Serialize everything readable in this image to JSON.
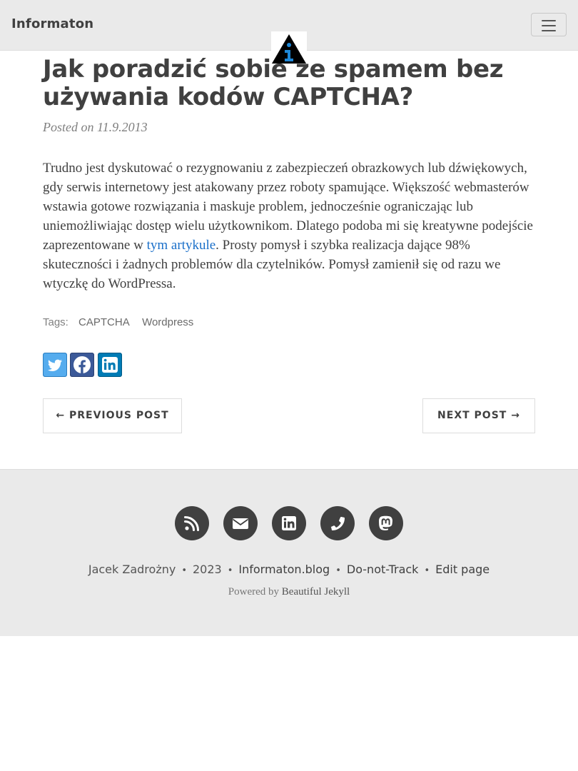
{
  "navbar": {
    "brand": "Informaton",
    "toggler_icon": "hamburger-menu-icon",
    "avatar_icon": "info-triangle-logo-icon"
  },
  "post": {
    "title": "Jak poradzić sobie ze spamem bez używania kodów CAPTCHA?",
    "meta": "Posted on 11.9.2013",
    "body_before_link": "Trudno jest dyskutować o rezygnowaniu z zabezpieczeń obrazkowych lub dźwiękowych, gdy serwis internetowy jest atakowany przez roboty spamujące. Większość webmasterów wstawia gotowe rozwiązania i maskuje problem, jednocześnie ograniczając lub uniemożliwiając dostęp wielu użytkownikom. Dlatego podoba mi się kreatywne podejście zaprezentowane w ",
    "body_link": "tym artykule",
    "body_after_link": ". Prosty pomysł i szybka realizacja dające 98% skuteczności i żadnych problemów dla czytelników. Pomysł zamienił się od razu we wtyczkę do WordPressa.",
    "tags_label": "Tags:",
    "tags": [
      "CAPTCHA",
      "Wordpress"
    ]
  },
  "share": [
    {
      "icon": "twitter-icon",
      "color": "#55acee"
    },
    {
      "icon": "facebook-icon",
      "color": "#3b5998"
    },
    {
      "icon": "linkedin-icon",
      "color": "#007bb5"
    }
  ],
  "pager": {
    "previous": "← PREVIOUS POST",
    "next": "NEXT POST →"
  },
  "footer": {
    "social_icons": [
      "rss-icon",
      "envelope-icon",
      "linkedin-icon",
      "phone-icon",
      "mastodon-icon"
    ],
    "author": "Jacek Zadrożny",
    "year": "2023",
    "site": "Informaton.blog",
    "dnt": "Do-not-Track",
    "edit": "Edit page",
    "powered_prefix": "Powered by",
    "powered_link": "Beautiful Jekyll",
    "separator": "•"
  },
  "colors": {
    "navbar_bg": "#eaeaea",
    "text": "#404040",
    "link": "#1a6fc9",
    "footer_bg": "#eaeaea"
  }
}
